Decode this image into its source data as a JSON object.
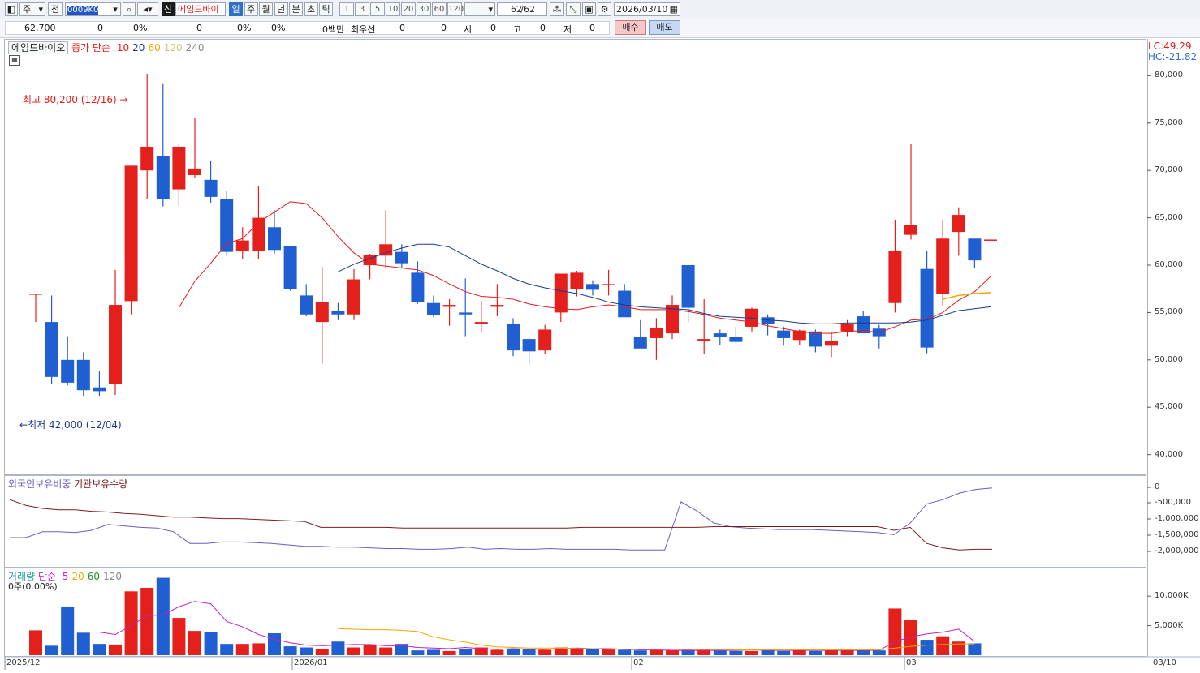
{
  "toolbar": {
    "type_label": "주",
    "scope_label": "전",
    "code_value": "0009K0",
    "badge": "신",
    "stock_name": "에임드바이",
    "periods": [
      "일",
      "주",
      "월",
      "년",
      "분",
      "초",
      "틱"
    ],
    "selected_period": "일",
    "intervals": [
      "1",
      "3",
      "5",
      "10",
      "20",
      "30",
      "60",
      "120"
    ],
    "count": "62",
    "count_total": "/62",
    "date": "2026/03/10"
  },
  "info": {
    "price": "62,700",
    "v1": "0",
    "p1": "0%",
    "v2": "0",
    "p2": "0%",
    "p3": "0%",
    "amount": "0백만",
    "priority": "최우선",
    "v3": "0",
    "v4": "0",
    "open_label": "시",
    "open": "0",
    "high_label": "고",
    "high": "0",
    "low_label": "저",
    "low": "0",
    "buy": "매수",
    "sell": "매도"
  },
  "price_panel": {
    "name": "에임드바이오",
    "legend_prefix": "종가 단순",
    "ma": [
      {
        "label": "10",
        "color": "#e31b1b"
      },
      {
        "label": "20",
        "color": "#1b3a8f"
      },
      {
        "label": "60",
        "color": "#f0a800"
      },
      {
        "label": "120",
        "color": "#c9c97a"
      },
      {
        "label": "240",
        "color": "#888888"
      }
    ],
    "lc": "LC:49.29",
    "hc": "HC:-21.82",
    "high_note": "최고 80,200 (12/16)",
    "low_note": "최저 42,000 (12/04)",
    "yticks": [
      "80,000",
      "75,000",
      "70,000",
      "65,000",
      "60,000",
      "55,000",
      "50,000",
      "45,000",
      "40,000"
    ]
  },
  "holding_panel": {
    "legend1": "외국인보유비중",
    "legend2": "기관보유수량",
    "yticks": [
      "0",
      "-500,000",
      "-1,000,000",
      "-1,500,000",
      "-2,000,000"
    ]
  },
  "volume_panel": {
    "legend_prefix": "거래량",
    "ma_prefix": "단순",
    "ma": [
      {
        "label": "5",
        "color": "#c41fc4"
      },
      {
        "label": "20",
        "color": "#f0a800"
      },
      {
        "label": "60",
        "color": "#2a8a2a"
      },
      {
        "label": "120",
        "color": "#888888"
      }
    ],
    "sub": "0주(0.00%)",
    "yticks": [
      "10,000K",
      "5,000K"
    ]
  },
  "xaxis": [
    "2025/12",
    "2026/01",
    "02",
    "03",
    "03/10"
  ],
  "chart_data": {
    "type": "candlestick",
    "ylim": [
      38000,
      82000
    ],
    "candles": [
      {
        "o": 57000,
        "h": 57000,
        "l": 54000,
        "c": 57000
      },
      {
        "o": 54000,
        "h": 56800,
        "l": 47500,
        "c": 48200
      },
      {
        "o": 50000,
        "h": 52500,
        "l": 47300,
        "c": 47600
      },
      {
        "o": 50000,
        "h": 50800,
        "l": 46200,
        "c": 46800
      },
      {
        "o": 47100,
        "h": 48800,
        "l": 46200,
        "c": 46700
      },
      {
        "o": 47500,
        "h": 59500,
        "l": 46300,
        "c": 55800
      },
      {
        "o": 56200,
        "h": 70200,
        "l": 54800,
        "c": 70500
      },
      {
        "o": 70000,
        "h": 80200,
        "l": 67000,
        "c": 72500
      },
      {
        "o": 71500,
        "h": 79200,
        "l": 66200,
        "c": 67000
      },
      {
        "o": 68000,
        "h": 72800,
        "l": 66300,
        "c": 72500
      },
      {
        "o": 69500,
        "h": 75500,
        "l": 69200,
        "c": 70200
      },
      {
        "o": 69000,
        "h": 71000,
        "l": 66600,
        "c": 67200
      },
      {
        "o": 67000,
        "h": 67800,
        "l": 61000,
        "c": 61400
      },
      {
        "o": 61500,
        "h": 64000,
        "l": 60600,
        "c": 62600
      },
      {
        "o": 61500,
        "h": 68300,
        "l": 60600,
        "c": 65000
      },
      {
        "o": 64000,
        "h": 65800,
        "l": 61200,
        "c": 61600
      },
      {
        "o": 62000,
        "h": 62000,
        "l": 57300,
        "c": 57500
      },
      {
        "o": 56800,
        "h": 58000,
        "l": 54600,
        "c": 54800
      },
      {
        "o": 54000,
        "h": 59800,
        "l": 49600,
        "c": 56100
      },
      {
        "o": 55200,
        "h": 56000,
        "l": 54200,
        "c": 54800
      },
      {
        "o": 54800,
        "h": 59600,
        "l": 54200,
        "c": 58500
      },
      {
        "o": 60000,
        "h": 61200,
        "l": 58500,
        "c": 61100
      },
      {
        "o": 61000,
        "h": 65800,
        "l": 59600,
        "c": 62200
      },
      {
        "o": 61400,
        "h": 62200,
        "l": 59700,
        "c": 60200
      },
      {
        "o": 59200,
        "h": 60400,
        "l": 55900,
        "c": 56100
      },
      {
        "o": 56000,
        "h": 56800,
        "l": 54500,
        "c": 54700
      },
      {
        "o": 55600,
        "h": 56400,
        "l": 53600,
        "c": 55800
      },
      {
        "o": 55000,
        "h": 58600,
        "l": 52500,
        "c": 54800
      },
      {
        "o": 53800,
        "h": 56200,
        "l": 52900,
        "c": 54000
      },
      {
        "o": 55600,
        "h": 58000,
        "l": 54600,
        "c": 55800
      },
      {
        "o": 53800,
        "h": 54400,
        "l": 50400,
        "c": 51000
      },
      {
        "o": 52200,
        "h": 52400,
        "l": 49500,
        "c": 50900
      },
      {
        "o": 51000,
        "h": 53700,
        "l": 50600,
        "c": 53200
      },
      {
        "o": 55000,
        "h": 59000,
        "l": 54000,
        "c": 59100
      },
      {
        "o": 57500,
        "h": 59400,
        "l": 56700,
        "c": 59200
      },
      {
        "o": 58000,
        "h": 58400,
        "l": 56800,
        "c": 57400
      },
      {
        "o": 58000,
        "h": 59500,
        "l": 56800,
        "c": 58000
      },
      {
        "o": 57300,
        "h": 58000,
        "l": 54600,
        "c": 54500
      },
      {
        "o": 52400,
        "h": 54200,
        "l": 51400,
        "c": 51200
      },
      {
        "o": 52300,
        "h": 54400,
        "l": 50000,
        "c": 53400
      },
      {
        "o": 52800,
        "h": 56800,
        "l": 52200,
        "c": 55800
      },
      {
        "o": 60000,
        "h": 60000,
        "l": 54000,
        "c": 55500
      },
      {
        "o": 52000,
        "h": 56400,
        "l": 50600,
        "c": 52200
      },
      {
        "o": 52800,
        "h": 53200,
        "l": 51600,
        "c": 52400
      },
      {
        "o": 52400,
        "h": 53500,
        "l": 51800,
        "c": 51900
      },
      {
        "o": 53500,
        "h": 55500,
        "l": 53000,
        "c": 55400
      },
      {
        "o": 54500,
        "h": 54800,
        "l": 52600,
        "c": 53800
      },
      {
        "o": 53100,
        "h": 53500,
        "l": 51500,
        "c": 52300
      },
      {
        "o": 52100,
        "h": 53200,
        "l": 51600,
        "c": 53100
      },
      {
        "o": 53000,
        "h": 53200,
        "l": 50800,
        "c": 51400
      },
      {
        "o": 51500,
        "h": 52900,
        "l": 50300,
        "c": 52000
      },
      {
        "o": 53000,
        "h": 54200,
        "l": 52500,
        "c": 53800
      },
      {
        "o": 54600,
        "h": 55200,
        "l": 53200,
        "c": 52800
      },
      {
        "o": 53300,
        "h": 53700,
        "l": 51200,
        "c": 52500
      },
      {
        "o": 56000,
        "h": 64800,
        "l": 55000,
        "c": 61500
      },
      {
        "o": 63200,
        "h": 72800,
        "l": 62700,
        "c": 64200
      },
      {
        "o": 59600,
        "h": 61500,
        "l": 50700,
        "c": 51300
      },
      {
        "o": 57000,
        "h": 64800,
        "l": 55700,
        "c": 62800
      },
      {
        "o": 63500,
        "h": 66100,
        "l": 61000,
        "c": 65300
      },
      {
        "o": 62800,
        "h": 62800,
        "l": 59700,
        "c": 60500
      },
      {
        "o": 62700,
        "h": 62700,
        "l": 62700,
        "c": 62700
      }
    ],
    "ma10": [
      null,
      null,
      null,
      null,
      null,
      null,
      null,
      null,
      null,
      55500,
      58300,
      60200,
      62300,
      62800,
      64500,
      65600,
      66700,
      66500,
      65000,
      63000,
      61300,
      60100,
      59900,
      59700,
      59500,
      58900,
      58000,
      57200,
      56700,
      56600,
      56400,
      55900,
      55600,
      55400,
      55300,
      55600,
      55800,
      55600,
      55300,
      55300,
      55300,
      55100,
      54800,
      54400,
      54200,
      54000,
      53600,
      53300,
      53000,
      52800,
      52800,
      53000,
      53100,
      52900,
      53500,
      54200,
      54300,
      55000,
      56300,
      57200,
      58800
    ],
    "ma20": [
      null,
      null,
      null,
      null,
      null,
      null,
      null,
      null,
      null,
      null,
      null,
      null,
      null,
      null,
      null,
      null,
      null,
      null,
      null,
      59300,
      60100,
      60700,
      61300,
      61800,
      62200,
      62200,
      61900,
      61000,
      60100,
      59400,
      58600,
      58000,
      57600,
      57300,
      57000,
      56600,
      56100,
      55800,
      55600,
      55500,
      55400,
      55300,
      54900,
      54600,
      54500,
      54400,
      54200,
      54100,
      53900,
      53800,
      53800,
      53900,
      53900,
      53900,
      53900,
      54000,
      54200,
      54700,
      55200,
      55400,
      55600
    ],
    "ma60": [
      null,
      null,
      null,
      null,
      null,
      null,
      null,
      null,
      null,
      null,
      null,
      null,
      null,
      null,
      null,
      null,
      null,
      null,
      null,
      null,
      null,
      null,
      null,
      null,
      null,
      null,
      null,
      null,
      null,
      null,
      null,
      null,
      null,
      null,
      null,
      null,
      null,
      null,
      null,
      null,
      null,
      null,
      null,
      null,
      null,
      null,
      null,
      null,
      null,
      null,
      null,
      null,
      null,
      null,
      null,
      null,
      null,
      56400,
      56800,
      57000,
      57100
    ],
    "foreign_ratio": [
      0.7,
      0.7,
      0.62,
      0.62,
      0.63,
      0.6,
      0.52,
      0.54,
      0.56,
      0.57,
      0.62,
      0.78,
      0.78,
      0.76,
      0.76,
      0.77,
      0.78,
      0.8,
      0.82,
      0.82,
      0.83,
      0.83,
      0.84,
      0.85,
      0.85,
      0.86,
      0.86,
      0.85,
      0.83,
      0.86,
      0.85,
      0.86,
      0.86,
      0.85,
      0.86,
      0.86,
      0.86,
      0.86,
      0.87,
      0.87,
      0.87,
      0.21,
      0.34,
      0.5,
      0.55,
      0.57,
      0.58,
      0.59,
      0.59,
      0.59,
      0.6,
      0.61,
      0.62,
      0.63,
      0.66,
      0.5,
      0.24,
      0.18,
      0.09,
      0.04,
      0.02
    ],
    "institution_qty": [
      0.18,
      0.26,
      0.3,
      0.32,
      0.32,
      0.34,
      0.35,
      0.37,
      0.38,
      0.4,
      0.42,
      0.42,
      0.43,
      0.44,
      0.44,
      0.45,
      0.46,
      0.47,
      0.48,
      0.56,
      0.56,
      0.56,
      0.56,
      0.56,
      0.57,
      0.57,
      0.57,
      0.57,
      0.57,
      0.57,
      0.57,
      0.57,
      0.57,
      0.57,
      0.57,
      0.56,
      0.56,
      0.56,
      0.56,
      0.56,
      0.56,
      0.56,
      0.56,
      0.55,
      0.55,
      0.55,
      0.55,
      0.55,
      0.55,
      0.55,
      0.55,
      0.55,
      0.55,
      0.55,
      0.6,
      0.56,
      0.78,
      0.84,
      0.87,
      0.86,
      0.86
    ],
    "volume_k": [
      4200,
      1600,
      8200,
      3800,
      1900,
      1800,
      10800,
      11400,
      13100,
      6300,
      4100,
      3900,
      1900,
      1900,
      2000,
      3700,
      1500,
      1300,
      1100,
      2300,
      1300,
      1800,
      1300,
      1900,
      800,
      900,
      700,
      1000,
      1300,
      900,
      1100,
      1000,
      900,
      1300,
      1200,
      1000,
      1100,
      900,
      800,
      900,
      800,
      900,
      900,
      800,
      700,
      700,
      900,
      700,
      800,
      700,
      800,
      800,
      900,
      800,
      7900,
      5900,
      2600,
      3200,
      2300,
      2000
    ],
    "volume_ma5_k": [
      null,
      null,
      null,
      null,
      3900,
      3500,
      5000,
      6700,
      6800,
      8200,
      9100,
      8700,
      5700,
      4800,
      3500,
      2700,
      2100,
      1700,
      1600,
      1700,
      1800,
      1800,
      1600,
      1600,
      1300,
      1200,
      1100,
      1300,
      1100,
      1000,
      1100,
      1000,
      1000,
      1100,
      1200,
      1100,
      1100,
      1000,
      900,
      900,
      800,
      800,
      800,
      800,
      800,
      900,
      800,
      800,
      800,
      800,
      800,
      800,
      800,
      800,
      2300,
      3100,
      3600,
      3900,
      4400,
      2300
    ],
    "volume_ma20_k": [
      null,
      null,
      null,
      null,
      null,
      null,
      null,
      null,
      null,
      null,
      null,
      null,
      null,
      null,
      null,
      null,
      null,
      null,
      null,
      4500,
      4400,
      4300,
      4300,
      4200,
      4000,
      3100,
      2600,
      2200,
      1700,
      1400,
      1300,
      1200,
      1200,
      1200,
      1100,
      1100,
      1000,
      1000,
      1000,
      1000,
      1000,
      950,
      950,
      950,
      900,
      900,
      900,
      900,
      900,
      900,
      900,
      900,
      900,
      900,
      1200,
      1500,
      1700,
      1800,
      1900,
      1900
    ],
    "volume_ymax_k": 14000
  }
}
